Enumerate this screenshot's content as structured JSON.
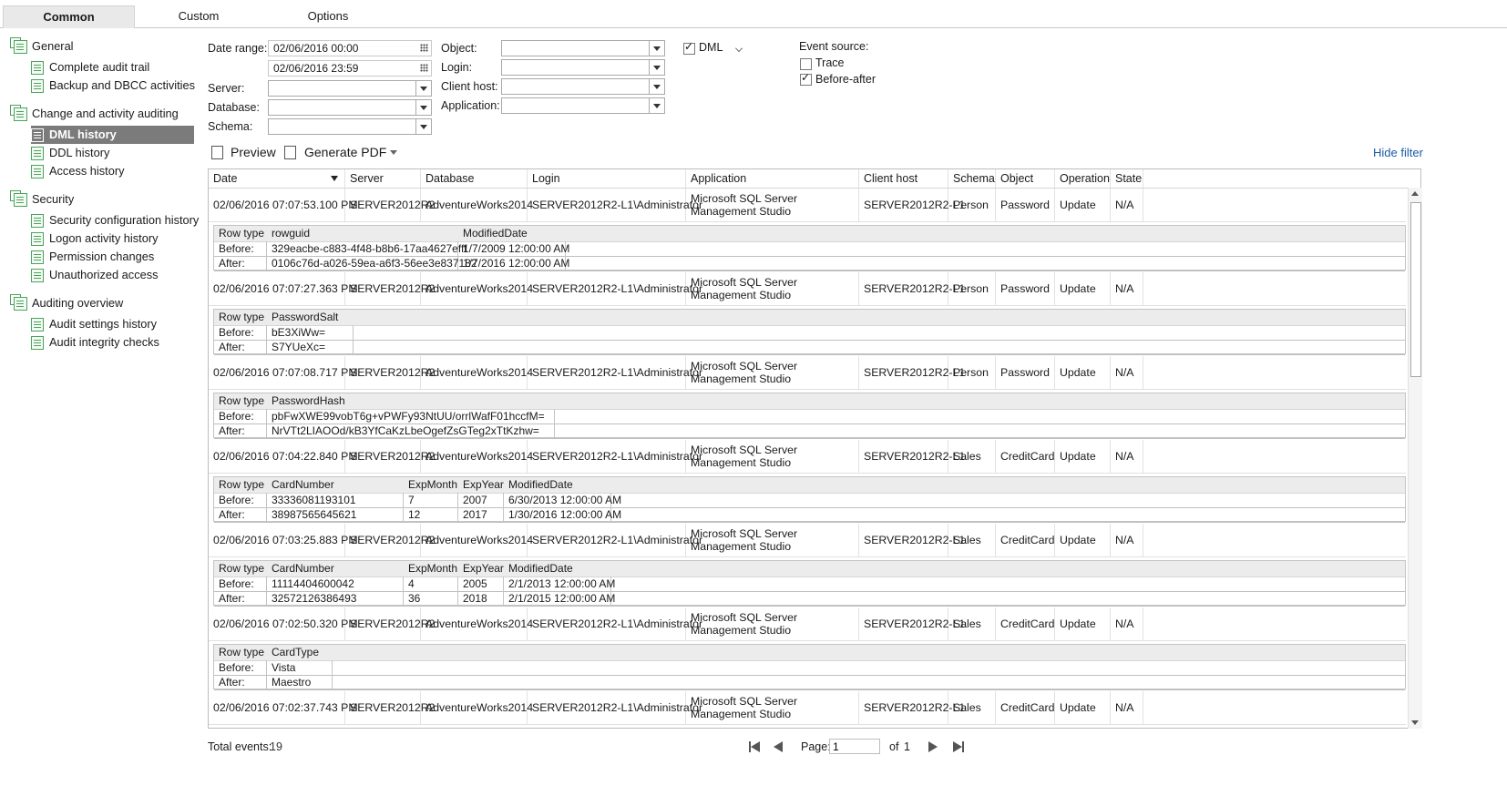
{
  "tabs": [
    "Common",
    "Custom",
    "Options"
  ],
  "sidebar": {
    "groups": [
      {
        "label": "General",
        "items": [
          "Complete audit trail",
          "Backup and DBCC activities"
        ]
      },
      {
        "label": "Change and activity auditing",
        "items": [
          "DML history",
          "DDL history",
          "Access history"
        ]
      },
      {
        "label": "Security",
        "items": [
          "Security configuration history",
          "Logon activity history",
          "Permission changes",
          "Unauthorized access"
        ]
      },
      {
        "label": "Auditing overview",
        "items": [
          "Audit settings history",
          "Audit integrity checks"
        ]
      }
    ],
    "selected": "DML history"
  },
  "filter": {
    "date_range_label": "Date range:",
    "date_from": "02/06/2016 00:00",
    "date_to": "02/06/2016 23:59",
    "server_label": "Server:",
    "database_label": "Database:",
    "schema_label": "Schema:",
    "object_label": "Object:",
    "login_label": "Login:",
    "client_host_label": "Client host:",
    "application_label": "Application:",
    "dml_label": "DML",
    "dml_checked": true,
    "event_source_label": "Event source:",
    "trace_label": "Trace",
    "trace_checked": false,
    "before_after_label": "Before-after",
    "before_after_checked": true
  },
  "toolbar": {
    "preview": "Preview",
    "generate_pdf": "Generate PDF",
    "hide_filter": "Hide filter"
  },
  "grid": {
    "columns": [
      "Date",
      "Server",
      "Database",
      "Login",
      "Application",
      "Client host",
      "Schema",
      "Object",
      "Operation",
      "State"
    ],
    "events": [
      {
        "date": "02/06/2016 07:07:53.100 PM",
        "server": "SERVER2012R2",
        "database": "AdventureWorks2014",
        "login": "SERVER2012R2-L1\\Administrator",
        "application": "Microsoft SQL Server Management Studio",
        "client_host": "SERVER2012R2-L1",
        "schema": "Person",
        "object": "Password",
        "operation": "Update",
        "state": "N/A",
        "detail": {
          "header": [
            "Row type",
            "rowguid",
            "ModifiedDate"
          ],
          "before": [
            "Before:",
            "329eacbe-c883-4f48-b8b6-17aa4627efff",
            "1/7/2009 12:00:00 AM"
          ],
          "after": [
            "After:",
            "0106c76d-a026-59ea-a6f3-56ee3e837182",
            "1/7/2016 12:00:00 AM"
          ]
        }
      },
      {
        "date": "02/06/2016 07:07:27.363 PM",
        "server": "SERVER2012R2",
        "database": "AdventureWorks2014",
        "login": "SERVER2012R2-L1\\Administrator",
        "application": "Microsoft SQL Server Management Studio",
        "client_host": "SERVER2012R2-L1",
        "schema": "Person",
        "object": "Password",
        "operation": "Update",
        "state": "N/A",
        "detail": {
          "header": [
            "Row type",
            "PasswordSalt"
          ],
          "before": [
            "Before:",
            "bE3XiWw="
          ],
          "after": [
            "After:",
            "S7YUeXc="
          ]
        }
      },
      {
        "date": "02/06/2016 07:07:08.717 PM",
        "server": "SERVER2012R2",
        "database": "AdventureWorks2014",
        "login": "SERVER2012R2-L1\\Administrator",
        "application": "Microsoft SQL Server Management Studio",
        "client_host": "SERVER2012R2-L1",
        "schema": "Person",
        "object": "Password",
        "operation": "Update",
        "state": "N/A",
        "detail": {
          "header": [
            "Row type",
            "PasswordHash"
          ],
          "before": [
            "Before:",
            "pbFwXWE99vobT6g+vPWFy93NtUU/orrlWafF01hccfM="
          ],
          "after": [
            "After:",
            "NrVTt2LIAOOd/kB3YfCaKzLbeOgefZsGTeg2xTtKzhw="
          ]
        }
      },
      {
        "date": "02/06/2016 07:04:22.840 PM",
        "server": "SERVER2012R2",
        "database": "AdventureWorks2014",
        "login": "SERVER2012R2-L1\\Administrator",
        "application": "Microsoft SQL Server Management Studio",
        "client_host": "SERVER2012R2-L1",
        "schema": "Sales",
        "object": "CreditCard",
        "operation": "Update",
        "state": "N/A",
        "detail": {
          "header": [
            "Row type",
            "CardNumber",
            "ExpMonth",
            "ExpYear",
            "ModifiedDate"
          ],
          "before": [
            "Before:",
            "33336081193101",
            "7",
            "2007",
            "6/30/2013 12:00:00 AM"
          ],
          "after": [
            "After:",
            "38987565645621",
            "12",
            "2017",
            "1/30/2016 12:00:00 AM"
          ]
        }
      },
      {
        "date": "02/06/2016 07:03:25.883 PM",
        "server": "SERVER2012R2",
        "database": "AdventureWorks2014",
        "login": "SERVER2012R2-L1\\Administrator",
        "application": "Microsoft SQL Server Management Studio",
        "client_host": "SERVER2012R2-L1",
        "schema": "Sales",
        "object": "CreditCard",
        "operation": "Update",
        "state": "N/A",
        "detail": {
          "header": [
            "Row type",
            "CardNumber",
            "ExpMonth",
            "ExpYear",
            "ModifiedDate"
          ],
          "before": [
            "Before:",
            "11114404600042",
            "4",
            "2005",
            "2/1/2013 12:00:00 AM"
          ],
          "after": [
            "After:",
            "32572126386493",
            "36",
            "2018",
            "2/1/2015 12:00:00 AM"
          ]
        }
      },
      {
        "date": "02/06/2016 07:02:50.320 PM",
        "server": "SERVER2012R2",
        "database": "AdventureWorks2014",
        "login": "SERVER2012R2-L1\\Administrator",
        "application": "Microsoft SQL Server Management Studio",
        "client_host": "SERVER2012R2-L1",
        "schema": "Sales",
        "object": "CreditCard",
        "operation": "Update",
        "state": "N/A",
        "detail": {
          "header": [
            "Row type",
            "CardType"
          ],
          "before": [
            "Before:",
            "Vista"
          ],
          "after": [
            "After:",
            "Maestro"
          ]
        }
      },
      {
        "date": "02/06/2016 07:02:37.743 PM",
        "server": "SERVER2012R2",
        "database": "AdventureWorks2014",
        "login": "SERVER2012R2-L1\\Administrator",
        "application": "Microsoft SQL Server Management Studio",
        "client_host": "SERVER2012R2-L1",
        "schema": "Sales",
        "object": "CreditCard",
        "operation": "Update",
        "state": "N/A"
      }
    ]
  },
  "footer": {
    "total_label": "Total events:",
    "total_value": "19",
    "page_label": "Page:",
    "page_value": "1",
    "of_label": "of",
    "of_value": "1"
  }
}
